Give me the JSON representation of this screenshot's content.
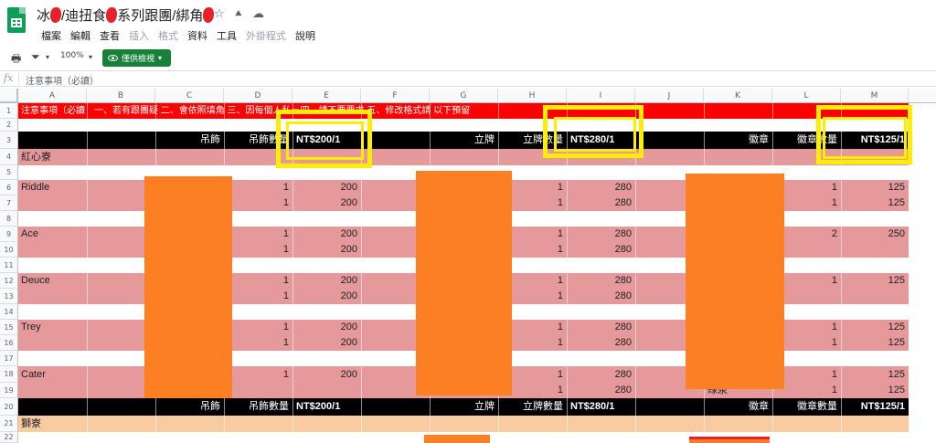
{
  "header": {
    "title_parts": [
      "冰",
      "/迪扭食",
      "系列跟團/綁角"
    ],
    "menu": [
      {
        "label": "檔案",
        "disabled": false
      },
      {
        "label": "編輯",
        "disabled": false
      },
      {
        "label": "查看",
        "disabled": false
      },
      {
        "label": "插入",
        "disabled": true
      },
      {
        "label": "格式",
        "disabled": true
      },
      {
        "label": "資料",
        "disabled": false
      },
      {
        "label": "工具",
        "disabled": false
      },
      {
        "label": "外掛程式",
        "disabled": true
      },
      {
        "label": "說明",
        "disabled": false
      }
    ]
  },
  "toolbar": {
    "zoom": "100%",
    "view_only_label": "僅供檢視"
  },
  "formula_bar": {
    "fx": "fx",
    "content": "注意事項（必讀）"
  },
  "columns": [
    "A",
    "B",
    "C",
    "D",
    "E",
    "F",
    "G",
    "H",
    "I",
    "J",
    "K",
    "L",
    "M"
  ],
  "rows": {
    "r1": "注意事項（必讀　一、若有跟團疑 二、會依照填角 三、因每個人私ㄧ四、請不要要求 五、修改格式請 以下預留",
    "r3": {
      "c": "吊飾",
      "d": "吊飾數量",
      "e": "NT$200/1",
      "g": "立牌",
      "h": "立牌數量",
      "i": "NT$280/1",
      "k": "徽章",
      "l": "徽章數量",
      "m": "NT$125/1"
    },
    "r4": "紅心寮",
    "r6": {
      "a": "Riddle",
      "d": "1",
      "e": "200",
      "h": "1",
      "i": "280",
      "l": "1",
      "m": "125"
    },
    "r7": {
      "d": "1",
      "e": "200",
      "h": "1",
      "i": "280",
      "l": "1",
      "m": "125"
    },
    "r9": {
      "a": "Ace",
      "d": "1",
      "e": "200",
      "h": "1",
      "i": "280",
      "l": "2",
      "m": "250"
    },
    "r10": {
      "d": "1",
      "e": "200",
      "h": "1",
      "i": "280"
    },
    "r12": {
      "a": "Deuce",
      "d": "1",
      "e": "200",
      "h": "1",
      "i": "280",
      "l": "1",
      "m": "125"
    },
    "r13": {
      "d": "1",
      "e": "200",
      "h": "1",
      "i": "280"
    },
    "r15": {
      "a": "Trey",
      "d": "1",
      "e": "200",
      "h": "1",
      "i": "280",
      "l": "1",
      "m": "125"
    },
    "r16": {
      "d": "1",
      "e": "200",
      "h": "1",
      "i": "280",
      "l": "1",
      "m": "125"
    },
    "r18": {
      "a": "Cater",
      "d": "1",
      "e": "200",
      "h": "1",
      "i": "280",
      "l": "1",
      "m": "125"
    },
    "r19": {
      "h": "1",
      "i": "280",
      "k": "綠泉",
      "l": "1",
      "m": "125"
    },
    "r20": {
      "c": "吊飾",
      "d": "吊飾數量",
      "e": "NT$200/1",
      "g": "立牌",
      "h": "立牌數量",
      "i": "NT$280/1",
      "k": "徽章",
      "l": "徽章數量",
      "m": "NT$125/1"
    },
    "r21": "獅寮"
  },
  "row_numbers": [
    "1",
    "2",
    "3",
    "4",
    "5",
    "6",
    "7",
    "8",
    "9",
    "10",
    "11",
    "12",
    "13",
    "14",
    "15",
    "16",
    "17",
    "18",
    "19",
    "20",
    "21",
    "22"
  ],
  "colors": {
    "accent": "#188038",
    "pink": "#e6999a",
    "red": "#ff0000",
    "peach": "#f8cba0",
    "redaction": "#fd7f23",
    "highlight": "#ffee00"
  }
}
